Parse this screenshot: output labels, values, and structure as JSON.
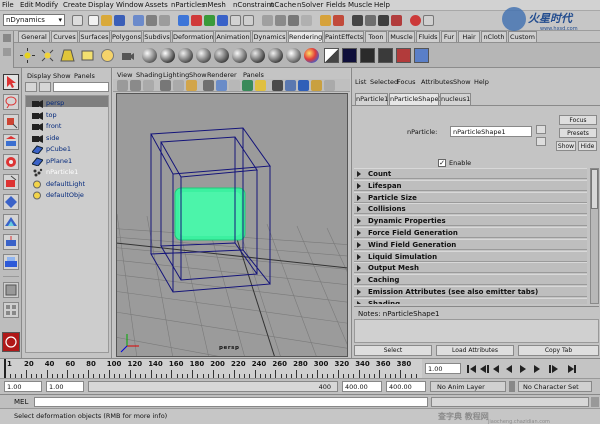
{
  "menubar": {
    "items": [
      "File",
      "Edit",
      "Modify",
      "Create",
      "Display",
      "Window",
      "Assets",
      "nParticles",
      "nMesh",
      "nConstraint",
      "nCache",
      "nSolver",
      "Fields",
      "Muscle",
      "Help"
    ]
  },
  "statusline": {
    "mode": "nDynamics"
  },
  "shelf": {
    "tabs": [
      "General",
      "Curves",
      "Surfaces",
      "Polygons",
      "Subdivs",
      "Deformation",
      "Animation",
      "Dynamics",
      "Rendering",
      "PaintEffects",
      "Toon",
      "Muscle",
      "Fluids",
      "Fur",
      "Hair",
      "nCloth",
      "Custom"
    ],
    "active_tab": "Rendering"
  },
  "outliner": {
    "menu": [
      "Display",
      "Show",
      "Panels"
    ],
    "items": [
      {
        "label": "persp",
        "icon": "camera-icon"
      },
      {
        "label": "top",
        "icon": "camera-icon"
      },
      {
        "label": "front",
        "icon": "camera-icon"
      },
      {
        "label": "side",
        "icon": "camera-icon"
      },
      {
        "label": "pCube1",
        "icon": "mesh-icon"
      },
      {
        "label": "pPlane1",
        "icon": "mesh-icon"
      },
      {
        "label": "nParticle1",
        "icon": "particle-icon"
      },
      {
        "label": "defaultLight",
        "icon": "light-icon"
      },
      {
        "label": "defaultObje",
        "icon": "light-icon"
      }
    ],
    "selected": "nParticle1"
  },
  "viewport": {
    "menu": [
      "View",
      "Shading",
      "Lighting",
      "Show",
      "Renderer",
      "Panels"
    ],
    "camera_label": "persp"
  },
  "attribute_editor": {
    "menu": [
      "List",
      "Selected",
      "Focus",
      "Attributes",
      "Show",
      "Help"
    ],
    "tabs": [
      "nParticle1",
      "nParticleShape1",
      "nucleus1"
    ],
    "active_tab": "nParticleShape1",
    "node_label": "nParticle:",
    "node_value": "nParticleShape1",
    "buttons": {
      "focus": "Focus",
      "presets": "Presets",
      "show": "Show",
      "hide": "Hide"
    },
    "enable_label": "Enable",
    "sections": [
      "Count",
      "Lifespan",
      "Particle Size",
      "Collisions",
      "Dynamic Properties",
      "Force Field Generation",
      "Wind Field Generation",
      "Liquid Simulation",
      "Output Mesh",
      "Caching",
      "Emission Attributes (see also emitter tabs)",
      "Shading"
    ],
    "notes_label": "Notes:  nParticleShape1",
    "bottom_buttons": {
      "select": "Select",
      "load": "Load Attributes",
      "copy": "Copy Tab"
    }
  },
  "timeslider": {
    "ticks": [
      "1",
      "20",
      "40",
      "60",
      "80",
      "100",
      "120",
      "140",
      "160",
      "180",
      "200",
      "220",
      "240",
      "260",
      "280",
      "300",
      "320",
      "340",
      "360",
      "380"
    ],
    "current_frame": "1.00"
  },
  "rangeslider": {
    "start": "1.00",
    "inner_start": "1.00",
    "inner_end": "400.00",
    "end": "400.00",
    "range_end_label": "400",
    "anim_layer": "No Anim Layer",
    "char_set": "No Character Set"
  },
  "cmdline": {
    "label": "MEL"
  },
  "helpline": {
    "text": "Select deformation objects (RMB for more info)"
  },
  "colors": {
    "particle": "#3cf0a0",
    "bbox": "#14147a",
    "section_arrow": "#222222"
  }
}
